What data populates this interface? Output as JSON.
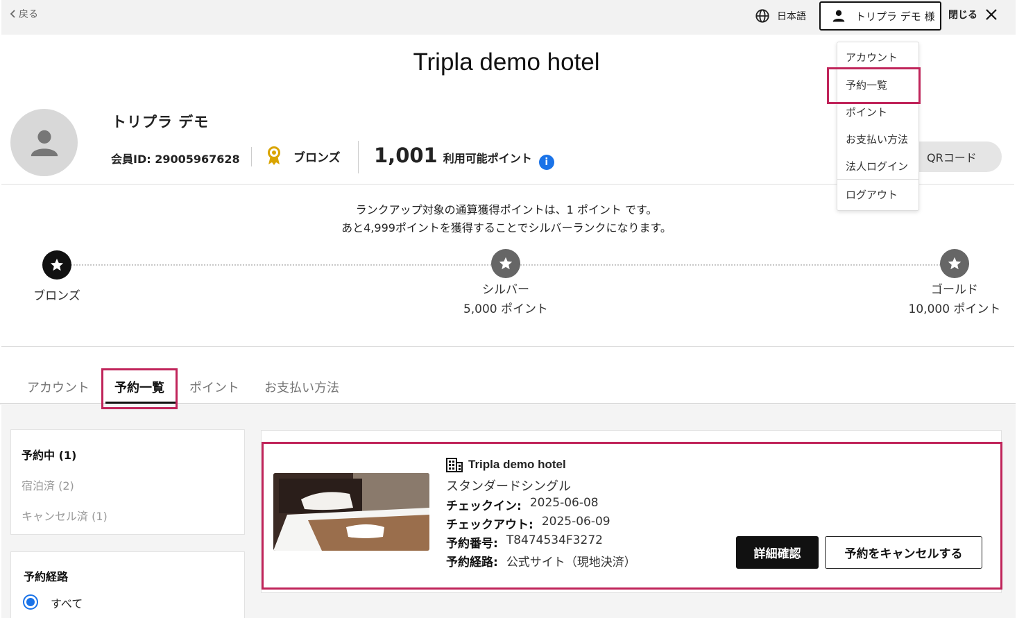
{
  "header": {
    "back_label": "戻る",
    "language_label": "日本語",
    "user_label": "トリプラ デモ 様",
    "close_label": "閉じる"
  },
  "hotel_title": "Tripla demo hotel",
  "user_menu": {
    "items": [
      "アカウント",
      "予約一覧",
      "ポイント",
      "お支払い方法",
      "法人ログイン"
    ],
    "logout": "ログアウト"
  },
  "profile": {
    "name": "トリプラ デモ",
    "member_id_label": "会員ID: 29005967628",
    "rank": "ブロンズ",
    "points": "1,001",
    "points_label": "利用可能ポイント",
    "info_icon": "i",
    "qr_label": "QRコード"
  },
  "rank_progress": {
    "message_line1": "ランクアップ対象の通算獲得ポイントは、1 ポイント です。",
    "message_line2": "あと4,999ポイントを獲得することでシルバーランクになります。",
    "levels": [
      {
        "name": "ブロンズ",
        "points": "",
        "current": true
      },
      {
        "name": "シルバー",
        "points": "5,000 ポイント",
        "current": false
      },
      {
        "name": "ゴールド",
        "points": "10,000 ポイント",
        "current": false
      }
    ]
  },
  "tabs": [
    {
      "label": "アカウント",
      "active": false
    },
    {
      "label": "予約一覧",
      "active": true
    },
    {
      "label": "ポイント",
      "active": false
    },
    {
      "label": "お支払い方法",
      "active": false
    }
  ],
  "reservation_filter": {
    "items": [
      {
        "label": "予約中 (1)",
        "active": true
      },
      {
        "label": "宿泊済 (2)",
        "active": false
      },
      {
        "label": "キャンセル済 (1)",
        "active": false
      }
    ]
  },
  "route_filter": {
    "title": "予約経路",
    "options": [
      {
        "label": "すべて",
        "selected": true
      }
    ]
  },
  "reservation": {
    "hotel": "Tripla demo hotel",
    "room": "スタンダードシングル",
    "checkin_label": "チェックイン:",
    "checkin": "2025-06-08",
    "checkout_label": "チェックアウト:",
    "checkout": "2025-06-09",
    "number_label": "予約番号:",
    "number": "T8474534F3272",
    "route_label": "予約経路:",
    "route": "公式サイト（現地決済）",
    "detail_button": "詳細確認",
    "cancel_button": "予約をキャンセルする"
  },
  "colors": {
    "highlight": "#c0245a",
    "accent": "#1a73e8",
    "primary_button": "#111111"
  }
}
